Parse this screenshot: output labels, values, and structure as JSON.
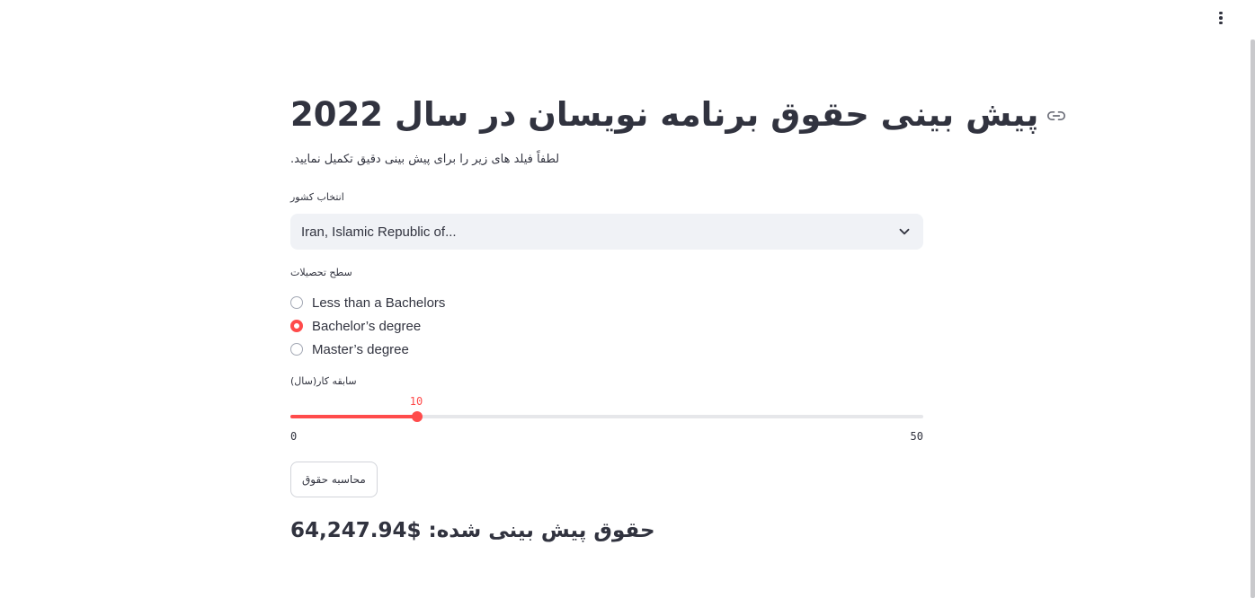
{
  "header": {
    "menu_icon": "vertical-ellipsis-icon"
  },
  "main": {
    "title": "پیش بینی حقوق برنامه نویسان در سال 2022",
    "title_link_icon": "link-icon",
    "subtitle": "لطفاً فیلد های زیر را برای پیش بینی دقیق تکمیل نمایید.",
    "country": {
      "label": "انتخاب کشور",
      "value": "Iran, Islamic Republic of...",
      "icon": "chevron-down-icon"
    },
    "education": {
      "label": "سطح تحصیلات",
      "options": [
        {
          "label": "Less than a Bachelors",
          "checked": false
        },
        {
          "label": "Bachelor’s degree",
          "checked": true
        },
        {
          "label": "Master’s degree",
          "checked": false
        }
      ]
    },
    "experience": {
      "label": "سابقه کار(سال)",
      "value": "10",
      "min": "0",
      "max": "50"
    },
    "calculate_button": "محاسبه حقوق",
    "result": "حقوق پیش بینی شده: $64,247.94"
  },
  "colors": {
    "accent": "#ff4b4b",
    "text": "#31333f",
    "input_bg": "#f0f2f6"
  }
}
